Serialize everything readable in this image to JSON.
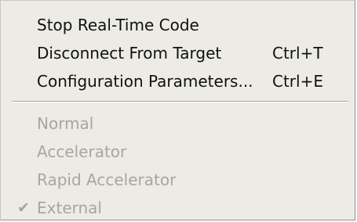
{
  "menu": {
    "items": [
      {
        "label": "Stop Real-Time Code",
        "shortcut": ""
      },
      {
        "label": "Disconnect From Target",
        "shortcut": "Ctrl+T"
      },
      {
        "label": "Configuration Parameters...",
        "shortcut": "Ctrl+E"
      }
    ],
    "modes": [
      {
        "label": "Normal",
        "checked": false,
        "enabled": false
      },
      {
        "label": "Accelerator",
        "checked": false,
        "enabled": false
      },
      {
        "label": "Rapid Accelerator",
        "checked": false,
        "enabled": false
      },
      {
        "label": "External",
        "checked": true,
        "enabled": false,
        "check_glyph": "✔"
      }
    ]
  }
}
